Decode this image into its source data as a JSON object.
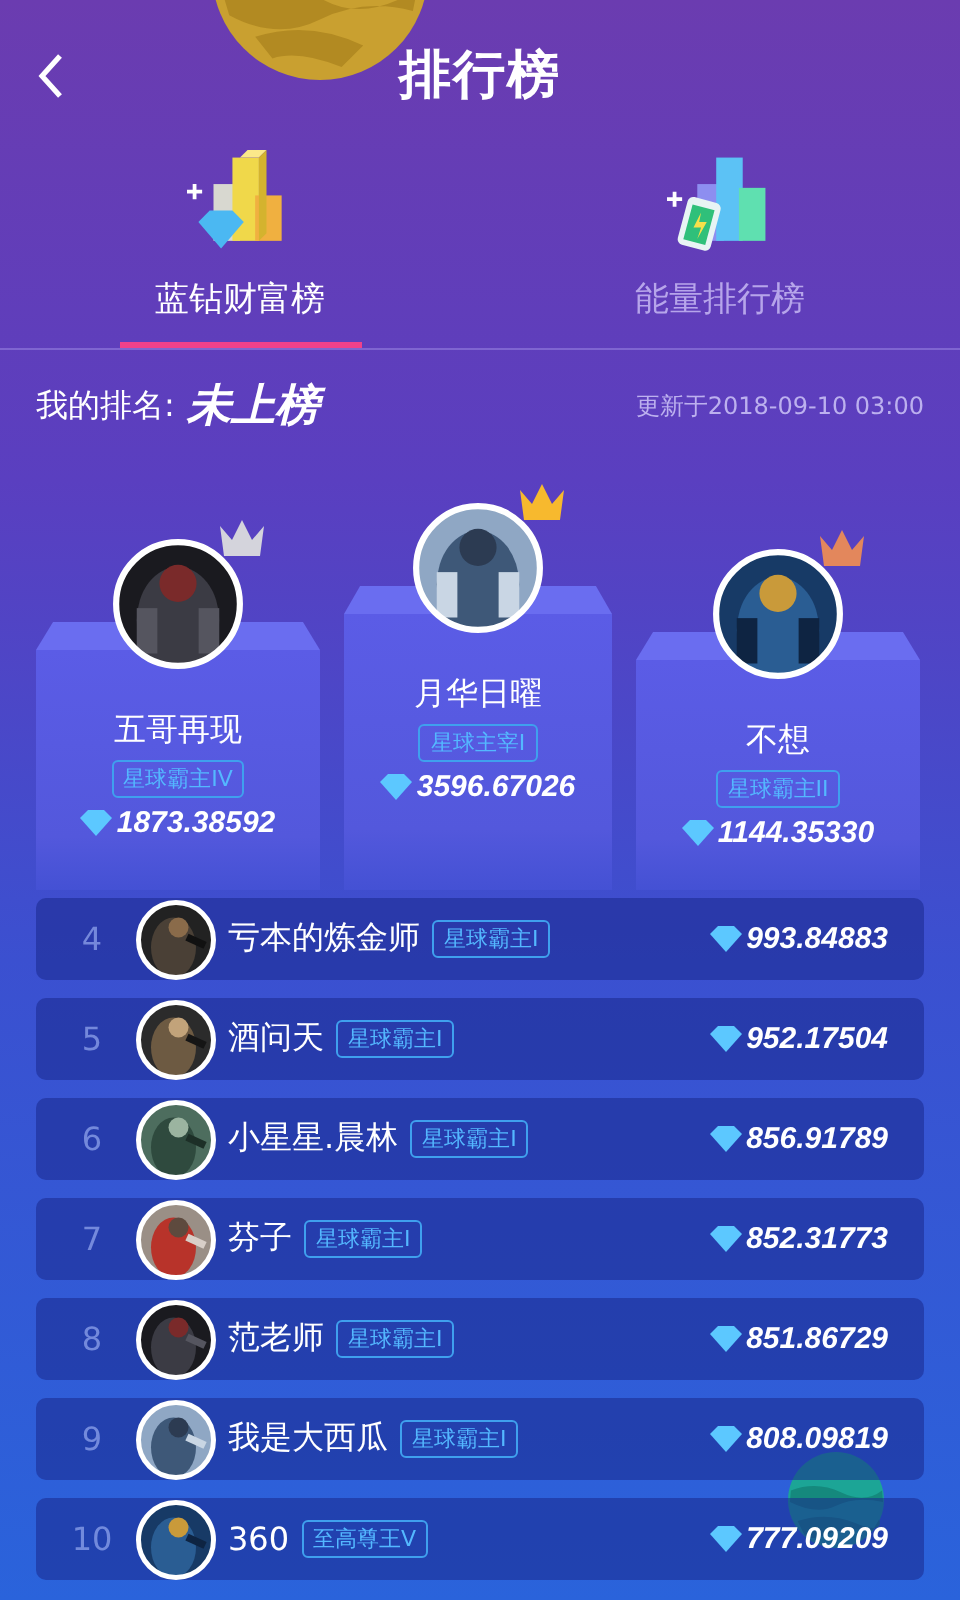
{
  "header": {
    "title": "排行榜"
  },
  "tabs": [
    {
      "label": "蓝钻财富榜",
      "selected": true,
      "kind": "diamond"
    },
    {
      "label": "能量排行榜",
      "selected": false,
      "kind": "energy"
    }
  ],
  "my_rank": {
    "label": "我的排名:",
    "value": "未上榜",
    "updated": "更新于2018-09-10 03:00"
  },
  "podium": [
    {
      "kind": "second",
      "name": "五哥再现",
      "title": "星球霸主IV",
      "score": "1873.38592",
      "color": "#d4d4dc"
    },
    {
      "kind": "first",
      "name": "月华日曜",
      "title": "星球主宰I",
      "score": "3596.67026",
      "color": "#f7b92e"
    },
    {
      "kind": "third",
      "name": "不想",
      "title": "星球霸主II",
      "score": "1144.35330",
      "color": "#e3875c"
    }
  ],
  "ranking": [
    {
      "rank": "4",
      "name": "亏本的炼金师",
      "title": "星球霸主I",
      "score": "993.84883"
    },
    {
      "rank": "5",
      "name": "酒问天",
      "title": "星球霸主I",
      "score": "952.17504"
    },
    {
      "rank": "6",
      "name": "小星星.晨林",
      "title": "星球霸主I",
      "score": "856.91789"
    },
    {
      "rank": "7",
      "name": "芬子",
      "title": "星球霸主I",
      "score": "852.31773"
    },
    {
      "rank": "8",
      "name": "范老师",
      "title": "星球霸主I",
      "score": "851.86729"
    },
    {
      "rank": "9",
      "name": "我是大西瓜",
      "title": "星球霸主I",
      "score": "808.09819"
    },
    {
      "rank": "10",
      "name": "360",
      "title": "至高尊王V",
      "score": "777.09209"
    }
  ]
}
